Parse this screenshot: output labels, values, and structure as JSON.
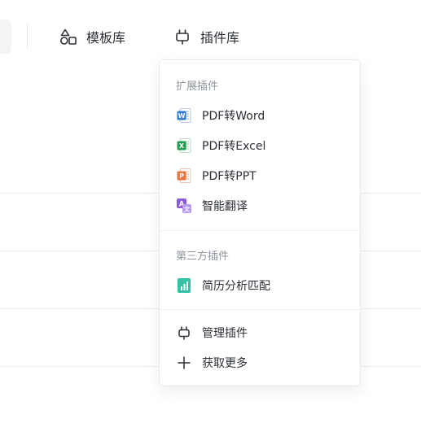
{
  "toolbar": {
    "templates_label": "模板库",
    "plugins_label": "插件库"
  },
  "dropdown": {
    "section_extension": "扩展插件",
    "extension_items": [
      {
        "label": "PDF转Word",
        "icon": "word-doc-icon",
        "color": "#2b7cd3"
      },
      {
        "label": "PDF转Excel",
        "icon": "excel-doc-icon",
        "color": "#1f9d55"
      },
      {
        "label": "PDF转PPT",
        "icon": "ppt-doc-icon",
        "color": "#e8743b"
      },
      {
        "label": "智能翻译",
        "icon": "translate-icon",
        "color": "#8a5cd9"
      }
    ],
    "section_third_party": "第三方插件",
    "third_party_items": [
      {
        "label": "简历分析匹配",
        "icon": "resume-chart-icon",
        "color": "#2ec4a6"
      }
    ],
    "footer_items": [
      {
        "label": "管理插件",
        "icon": "plug-icon"
      },
      {
        "label": "获取更多",
        "icon": "plus-icon"
      }
    ]
  }
}
